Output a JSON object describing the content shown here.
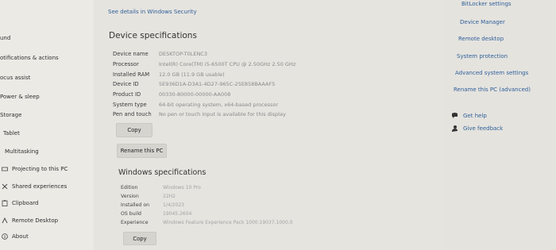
{
  "top_link": "See details in Windows Security",
  "sidebar": {
    "items": [
      {
        "label": "und",
        "icon": "none"
      },
      {
        "label": "otifications & actions",
        "icon": "none"
      },
      {
        "label": "ocus assist",
        "icon": "none"
      },
      {
        "label": "Power & sleep",
        "icon": "none"
      },
      {
        "label": "Storage",
        "icon": "none"
      },
      {
        "label": "Tablet",
        "icon": "none"
      },
      {
        "label": "Multitasking",
        "icon": "none"
      },
      {
        "label": "Projecting to this PC",
        "icon": "projector-icon"
      },
      {
        "label": "Shared experiences",
        "icon": "shared-icon"
      },
      {
        "label": "Clipboard",
        "icon": "clipboard-icon"
      },
      {
        "label": "Remote Desktop",
        "icon": "remote-desktop-icon"
      },
      {
        "label": "About",
        "icon": "info-icon"
      }
    ]
  },
  "device": {
    "title": "Device specifications",
    "rows": [
      {
        "label": "Device name",
        "value": "DESKTOP-T0LENC3"
      },
      {
        "label": "Processor",
        "value": "Intel(R) Core(TM) i5-6500T CPU @ 2.50GHz   2.50 GHz"
      },
      {
        "label": "Installed RAM",
        "value": "12.0 GB (11.9 GB usable)"
      },
      {
        "label": "Device ID",
        "value": "5E936D1A-D3A1-4D27-965C-25E858BAAAF5"
      },
      {
        "label": "Product ID",
        "value": "00330-80000-00000-AA008"
      },
      {
        "label": "System type",
        "value": "64-bit operating system, x64-based processor"
      },
      {
        "label": "Pen and touch",
        "value": "No pen or touch input is available for this display"
      }
    ],
    "copy_label": "Copy",
    "rename_label": "Rename this PC"
  },
  "windows": {
    "title": "Windows specifications",
    "rows": [
      {
        "label": "Edition",
        "value": "Windows 10 Pro"
      },
      {
        "label": "Version",
        "value": "22H2"
      },
      {
        "label": "Installed on",
        "value": "1/4/2023"
      },
      {
        "label": "OS build",
        "value": "19045.2604"
      },
      {
        "label": "Experience",
        "value": "Windows Feature Experience Pack 1000.19037.1000.0"
      }
    ],
    "copy_label": "Copy"
  },
  "related": {
    "links": [
      "BitLocker settings",
      "Device Manager",
      "Remote desktop",
      "System protection",
      "Advanced system settings",
      "Rename this PC (advanced)"
    ],
    "help": [
      {
        "label": "Get help",
        "icon": "help-icon"
      },
      {
        "label": "Give feedback",
        "icon": "feedback-icon"
      }
    ]
  },
  "colors": {
    "link": "#2d5f9a",
    "background": "#e6e4df"
  }
}
